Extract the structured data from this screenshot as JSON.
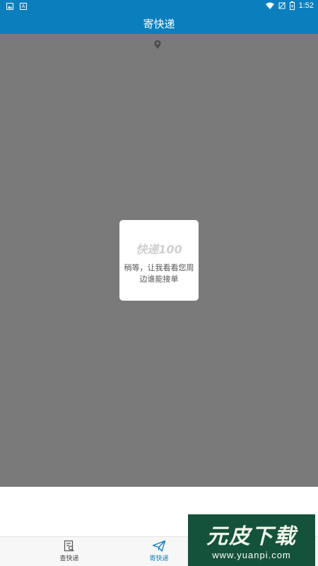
{
  "status_bar": {
    "time": "1:52",
    "left_icons": [
      "image-icon",
      "a-icon"
    ],
    "right_icons": [
      "wifi-icon",
      "no-signal-icon",
      "battery-charging-icon"
    ],
    "a_glyph": "A"
  },
  "app_bar": {
    "title": "寄快递",
    "background": "#0b7fbd"
  },
  "map": {
    "background": "#7a7a7b",
    "pin_icon": "location-pin-icon"
  },
  "dialog": {
    "logo_text": "快递100",
    "message": "稍等，让我看看您周边谁能接单"
  },
  "bottom_nav": {
    "items": [
      {
        "label": "查快递",
        "icon": "search-document-icon",
        "active": false
      },
      {
        "label": "寄快递",
        "icon": "send-plane-icon",
        "active": true
      }
    ],
    "active_color": "#0b7fbd"
  },
  "watermark": {
    "title": "元皮下载",
    "url": "www.yuanpi.com"
  }
}
